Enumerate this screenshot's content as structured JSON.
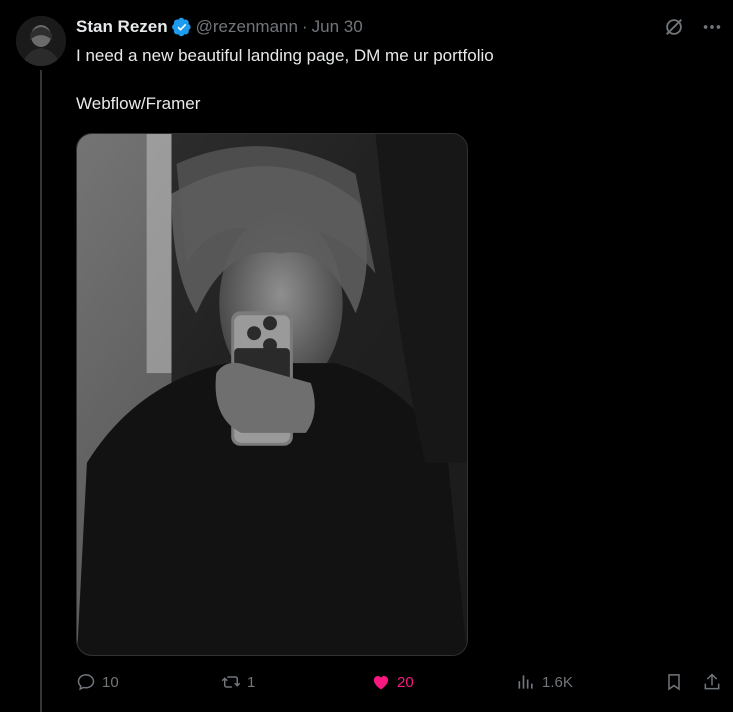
{
  "tweet": {
    "author_name": "Stan Rezen",
    "handle": "@rezenmann",
    "separator": "·",
    "date": "Jun 30",
    "text_line1": "I need a new beautiful landing page, DM me ur portfolio",
    "text_line2": "Webflow/Framer"
  },
  "actions": {
    "replies": "10",
    "reposts": "1",
    "likes": "20",
    "views": "1.6K"
  },
  "colors": {
    "background": "#000000",
    "text": "#e7e9ea",
    "muted": "#71767b",
    "verified": "#1d9bf0",
    "like": "#f91880"
  },
  "icons": [
    "grok-icon",
    "more-icon",
    "reply-icon",
    "repost-icon",
    "like-heart-icon",
    "views-icon",
    "bookmark-icon",
    "share-icon",
    "verified-badge-icon"
  ]
}
